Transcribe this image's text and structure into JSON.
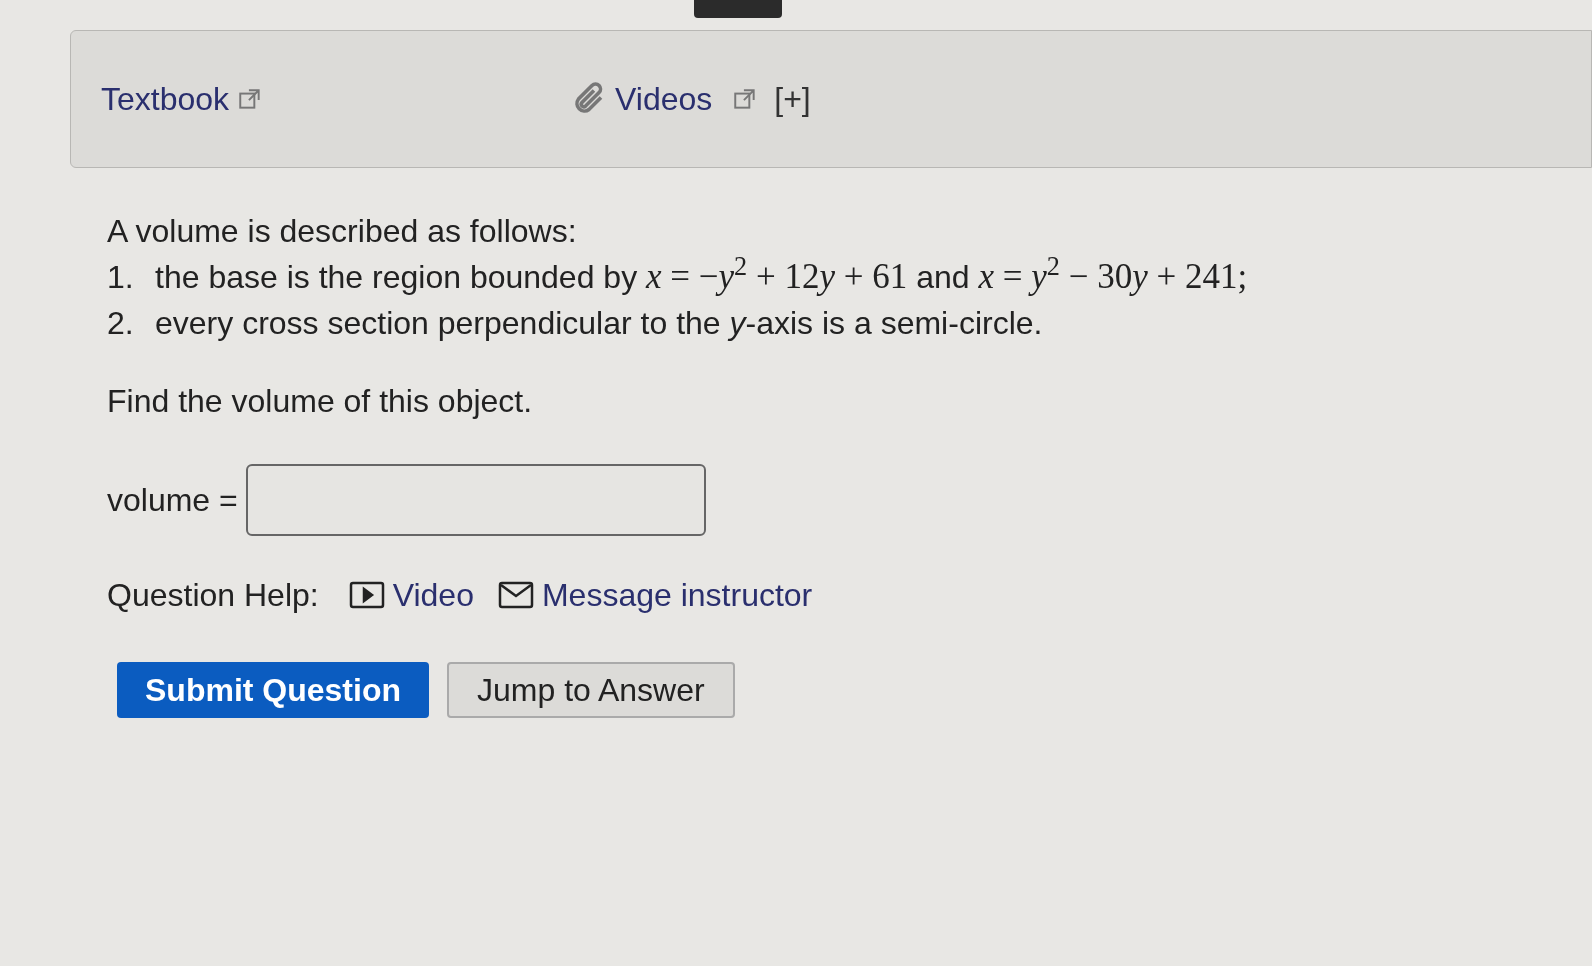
{
  "resources": {
    "textbook": "Textbook",
    "videos": "Videos",
    "expand": "[+]"
  },
  "question": {
    "intro": "A volume is described as follows:",
    "items": [
      {
        "number": "1.",
        "parts": [
          {
            "kind": "text",
            "text": "the base is the region bounded by "
          },
          {
            "kind": "math",
            "text": "*x* = −*y*$^{2}$ + 12"
          },
          {
            "kind": "var",
            "text": "y"
          },
          {
            "kind": "math",
            "text": " + 61"
          },
          {
            "kind": "text",
            "text": " and "
          },
          {
            "kind": "math",
            "text": "*x* = *y*$^{2}$ − 30"
          },
          {
            "kind": "var",
            "text": "y"
          },
          {
            "kind": "math",
            "text": " + 241;"
          }
        ]
      },
      {
        "number": "2.",
        "parts": [
          {
            "kind": "text",
            "text": "every cross section perpendicular to the *y*-axis is a semi-circle."
          }
        ]
      }
    ],
    "prompt": "Find the volume of this object.",
    "answer_label": "volume ="
  },
  "help": {
    "label": "Question Help:",
    "links": [
      {
        "kind": "video",
        "label": "Video"
      },
      {
        "kind": "message",
        "label": "Message instructor"
      }
    ]
  },
  "buttons": [
    {
      "kind": "primary",
      "label": "Submit Question"
    },
    {
      "kind": "secondary",
      "label": "Jump to Answer"
    }
  ]
}
